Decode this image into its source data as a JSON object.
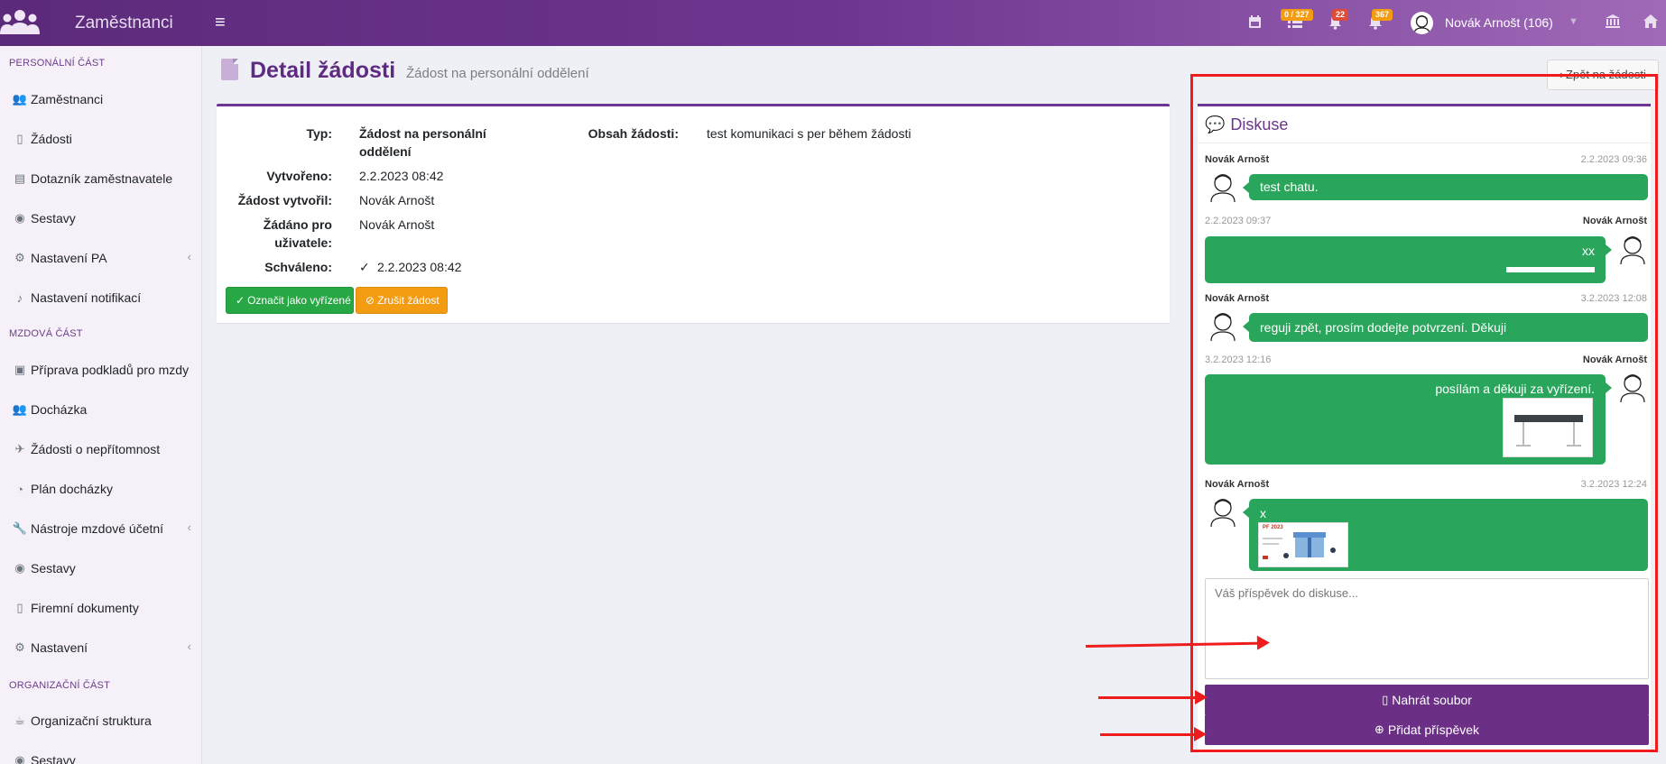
{
  "navbar": {
    "brand": "Zaměstnanci",
    "badge_tasks": "0 / 327",
    "badge_bell": "22",
    "badge_alerts": "367",
    "user": "Novák Arnošt (106)",
    "colors": {
      "badge_orange": "#f39c12",
      "badge_red": "#dd4b39"
    }
  },
  "sidebar": {
    "sections": [
      "PERSONÁLNÍ ČÁST",
      "MZDOVÁ ČÁST",
      "ORGANIZAČNÍ ČÁST"
    ],
    "items": [
      {
        "label": "Zaměstnanci",
        "icon": "users-icon"
      },
      {
        "label": "Žádosti",
        "icon": "file-icon"
      },
      {
        "label": "Dotazník zaměstnavatele",
        "icon": "clipboard-icon"
      },
      {
        "label": "Sestavy",
        "icon": "eye-icon"
      },
      {
        "label": "Nastavení PA",
        "icon": "cogs-icon"
      },
      {
        "label": "Nastavení notifikací",
        "icon": "bell-icon"
      },
      {
        "label": "Příprava podkladů pro mzdy",
        "icon": "money-icon"
      },
      {
        "label": "Docházka",
        "icon": "users-icon"
      },
      {
        "label": "Žádosti o nepřítomnost",
        "icon": "plane-icon"
      },
      {
        "label": "Plán docházky",
        "icon": "clock-icon"
      },
      {
        "label": "Nástroje mzdové účetní",
        "icon": "wrench-icon"
      },
      {
        "label": "Sestavy",
        "icon": "eye-icon"
      },
      {
        "label": "Firemní dokumenty",
        "icon": "file-icon"
      },
      {
        "label": "Nastavení",
        "icon": "cogs-icon"
      },
      {
        "label": "Organizační struktura",
        "icon": "coffee-icon"
      },
      {
        "label": "Sestavy",
        "icon": "eye-icon"
      }
    ]
  },
  "page": {
    "title": "Detail žádosti",
    "subtitle": "Žádost na personální oddělení",
    "back": "‹ Zpět na žádosti"
  },
  "detail": {
    "type_label": "Typ:",
    "type_value_1": "Žádost na personální",
    "type_value_2": "oddělení",
    "content_label": "Obsah žádosti:",
    "content_value": "test komunikaci s per během žádosti",
    "created_label": "Vytvořeno:",
    "created_value": "2.2.2023 08:42",
    "creator_label": "Žádost vytvořil:",
    "creator_value": "Novák Arnošt",
    "requested_for_label_1": "Žádáno pro",
    "requested_for_label_2": "uživatele:",
    "requested_for_value": "Novák Arnošt",
    "approved_label": "Schváleno:",
    "approved_value": "2.2.2023 08:42",
    "btn_resolve": "Označit jako vyřízené",
    "btn_cancel": "Zrušit žádost"
  },
  "discussion": {
    "title": "Diskuse",
    "messages": [
      {
        "author": "Novák Arnošt",
        "time": "2.2.2023 09:36",
        "text": "test chatu.",
        "side": "left"
      },
      {
        "author": "Novák Arnošt",
        "time": "2.2.2023 09:37",
        "text": "xx",
        "side": "right"
      },
      {
        "author": "Novák Arnošt",
        "time": "3.2.2023 12:08",
        "text": "reguji zpět, prosím dodejte potvrzení. Děkuji",
        "side": "left"
      },
      {
        "author": "Novák Arnošt",
        "time": "3.2.2023 12:16",
        "text": "posílám a děkuji za vyřízení.",
        "side": "right"
      },
      {
        "author": "Novák Arnošt",
        "time": "3.2.2023 12:24",
        "text": "x",
        "side": "left"
      }
    ],
    "thumb_pf_text": "PF 2023",
    "placeholder": "Váš příspěvek do diskuse...",
    "btn_upload": "Nahrát soubor",
    "btn_add": "Přidat příspěvek"
  },
  "annotation_color": "#ee1c1c"
}
